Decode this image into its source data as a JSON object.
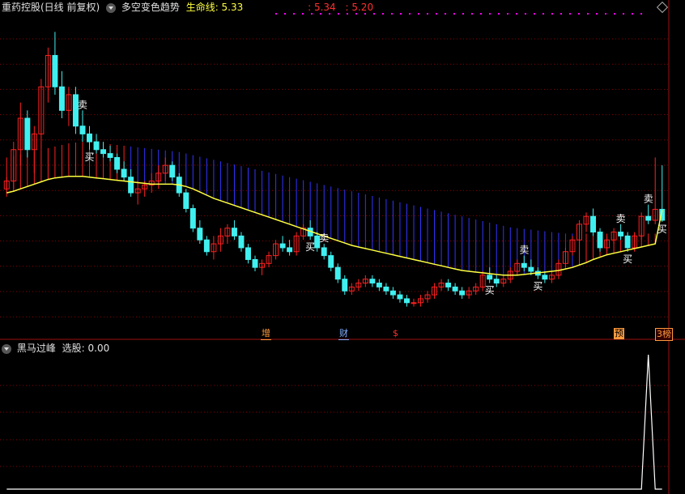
{
  "header_main": {
    "stock_title": "重药控股(日线 前复权)",
    "indicator_name": "多空变色趋势",
    "lifeline_label": "生命线: 5.33",
    "price_a": ": 5.34",
    "price_b": ": 5.20"
  },
  "header_sub": {
    "indicator_name": "黑马过峰",
    "pick_label": "选股: 0.00"
  },
  "signals": {
    "buy": "买",
    "sell": "卖"
  },
  "event_markers": [
    "增",
    "财",
    "$",
    "预",
    "3榜"
  ],
  "colors": {
    "background": "#000000",
    "up": "#ff2020",
    "down": "#40f0f0",
    "lifeline": "#ffff40",
    "band": "#3333ff",
    "grid": "#8b0000",
    "divider": "#a01010"
  },
  "chart_data": {
    "type": "candlestick",
    "ohlc": [
      [
        5.6,
        5.75,
        5.5,
        5.7
      ],
      [
        5.7,
        6.2,
        5.6,
        6.1
      ],
      [
        6.1,
        6.7,
        5.9,
        6.5
      ],
      [
        6.5,
        6.6,
        6.0,
        6.1
      ],
      [
        6.1,
        6.4,
        5.8,
        6.3
      ],
      [
        6.3,
        7.0,
        6.1,
        6.9
      ],
      [
        6.9,
        7.4,
        6.7,
        7.3
      ],
      [
        7.3,
        7.6,
        6.8,
        6.9
      ],
      [
        6.9,
        7.1,
        6.5,
        6.6
      ],
      [
        6.6,
        6.9,
        6.4,
        6.8
      ],
      [
        6.8,
        6.9,
        6.3,
        6.4
      ],
      [
        6.4,
        6.6,
        6.2,
        6.3
      ],
      [
        6.3,
        6.4,
        6.1,
        6.2
      ],
      [
        6.2,
        6.3,
        6.05,
        6.1
      ],
      [
        6.1,
        6.2,
        6.0,
        6.05
      ],
      [
        6.05,
        6.15,
        5.95,
        6.0
      ],
      [
        6.0,
        6.05,
        5.8,
        5.85
      ],
      [
        5.85,
        5.95,
        5.7,
        5.75
      ],
      [
        5.75,
        5.85,
        5.5,
        5.55
      ],
      [
        5.55,
        5.7,
        5.4,
        5.6
      ],
      [
        5.6,
        5.7,
        5.5,
        5.65
      ],
      [
        5.65,
        5.8,
        5.55,
        5.7
      ],
      [
        5.7,
        5.9,
        5.6,
        5.8
      ],
      [
        5.8,
        6.0,
        5.7,
        5.9
      ],
      [
        5.9,
        5.95,
        5.7,
        5.75
      ],
      [
        5.75,
        5.8,
        5.5,
        5.55
      ],
      [
        5.55,
        5.6,
        5.3,
        5.35
      ],
      [
        5.35,
        5.4,
        5.05,
        5.1
      ],
      [
        5.1,
        5.2,
        4.9,
        4.95
      ],
      [
        4.95,
        5.0,
        4.75,
        4.8
      ],
      [
        4.8,
        5.0,
        4.7,
        4.9
      ],
      [
        4.9,
        5.1,
        4.8,
        5.0
      ],
      [
        5.0,
        5.15,
        4.9,
        5.1
      ],
      [
        5.1,
        5.2,
        4.95,
        5.0
      ],
      [
        5.0,
        5.05,
        4.8,
        4.85
      ],
      [
        4.85,
        4.9,
        4.65,
        4.7
      ],
      [
        4.7,
        4.75,
        4.55,
        4.6
      ],
      [
        4.6,
        4.7,
        4.5,
        4.65
      ],
      [
        4.65,
        4.8,
        4.6,
        4.75
      ],
      [
        4.75,
        4.95,
        4.7,
        4.9
      ],
      [
        4.9,
        5.0,
        4.8,
        4.85
      ],
      [
        4.85,
        4.95,
        4.75,
        4.8
      ],
      [
        4.8,
        5.05,
        4.75,
        5.0
      ],
      [
        5.0,
        5.15,
        4.95,
        5.1
      ],
      [
        5.1,
        5.2,
        4.95,
        5.0
      ],
      [
        5.0,
        5.05,
        4.8,
        4.85
      ],
      [
        4.85,
        4.9,
        4.7,
        4.75
      ],
      [
        4.75,
        4.8,
        4.55,
        4.6
      ],
      [
        4.6,
        4.65,
        4.4,
        4.45
      ],
      [
        4.45,
        4.5,
        4.25,
        4.3
      ],
      [
        4.3,
        4.4,
        4.25,
        4.35
      ],
      [
        4.35,
        4.45,
        4.3,
        4.4
      ],
      [
        4.4,
        4.5,
        4.35,
        4.45
      ],
      [
        4.45,
        4.5,
        4.35,
        4.4
      ],
      [
        4.4,
        4.45,
        4.3,
        4.35
      ],
      [
        4.35,
        4.4,
        4.25,
        4.3
      ],
      [
        4.3,
        4.35,
        4.2,
        4.25
      ],
      [
        4.25,
        4.3,
        4.15,
        4.2
      ],
      [
        4.2,
        4.25,
        4.1,
        4.15
      ],
      [
        4.15,
        4.2,
        4.1,
        4.15
      ],
      [
        4.15,
        4.25,
        4.1,
        4.2
      ],
      [
        4.2,
        4.3,
        4.15,
        4.25
      ],
      [
        4.25,
        4.4,
        4.2,
        4.35
      ],
      [
        4.35,
        4.45,
        4.3,
        4.4
      ],
      [
        4.4,
        4.45,
        4.3,
        4.35
      ],
      [
        4.35,
        4.4,
        4.25,
        4.3
      ],
      [
        4.3,
        4.35,
        4.2,
        4.25
      ],
      [
        4.25,
        4.35,
        4.2,
        4.3
      ],
      [
        4.3,
        4.4,
        4.25,
        4.35
      ],
      [
        4.35,
        4.55,
        4.3,
        4.5
      ],
      [
        4.5,
        4.6,
        4.4,
        4.45
      ],
      [
        4.45,
        4.5,
        4.35,
        4.4
      ],
      [
        4.4,
        4.5,
        4.35,
        4.45
      ],
      [
        4.45,
        4.6,
        4.4,
        4.55
      ],
      [
        4.55,
        4.7,
        4.5,
        4.65
      ],
      [
        4.65,
        4.75,
        4.55,
        4.6
      ],
      [
        4.6,
        4.7,
        4.5,
        4.55
      ],
      [
        4.55,
        4.6,
        4.45,
        4.5
      ],
      [
        4.5,
        4.55,
        4.4,
        4.45
      ],
      [
        4.45,
        4.55,
        4.4,
        4.5
      ],
      [
        4.5,
        4.7,
        4.45,
        4.65
      ],
      [
        4.65,
        4.85,
        4.6,
        4.8
      ],
      [
        4.8,
        5.0,
        4.75,
        4.95
      ],
      [
        4.95,
        5.2,
        4.9,
        5.15
      ],
      [
        5.15,
        5.3,
        5.05,
        5.25
      ],
      [
        5.25,
        5.35,
        5.0,
        5.05
      ],
      [
        5.05,
        5.1,
        4.8,
        4.85
      ],
      [
        4.85,
        5.0,
        4.8,
        4.95
      ],
      [
        4.95,
        5.1,
        4.9,
        5.05
      ],
      [
        5.05,
        5.15,
        4.95,
        5.0
      ],
      [
        5.0,
        5.05,
        4.8,
        4.85
      ],
      [
        4.85,
        5.05,
        4.8,
        5.0
      ],
      [
        5.0,
        5.3,
        4.95,
        5.25
      ],
      [
        5.25,
        5.4,
        5.15,
        5.2
      ],
      [
        5.2,
        6.0,
        5.15,
        5.34
      ],
      [
        5.34,
        5.9,
        5.18,
        5.2
      ]
    ],
    "lifeline": [
      5.55,
      5.57,
      5.6,
      5.63,
      5.66,
      5.69,
      5.72,
      5.74,
      5.75,
      5.76,
      5.76,
      5.76,
      5.75,
      5.74,
      5.73,
      5.72,
      5.71,
      5.7,
      5.69,
      5.68,
      5.67,
      5.66,
      5.66,
      5.66,
      5.66,
      5.65,
      5.63,
      5.6,
      5.56,
      5.52,
      5.48,
      5.45,
      5.42,
      5.39,
      5.36,
      5.33,
      5.3,
      5.27,
      5.24,
      5.21,
      5.18,
      5.15,
      5.12,
      5.09,
      5.06,
      5.03,
      5.0,
      4.97,
      4.94,
      4.91,
      4.88,
      4.86,
      4.84,
      4.82,
      4.8,
      4.78,
      4.76,
      4.74,
      4.72,
      4.7,
      4.68,
      4.66,
      4.64,
      4.62,
      4.6,
      4.58,
      4.56,
      4.55,
      4.54,
      4.53,
      4.52,
      4.51,
      4.5,
      4.5,
      4.5,
      4.51,
      4.52,
      4.53,
      4.54,
      4.55,
      4.56,
      4.58,
      4.6,
      4.63,
      4.66,
      4.7,
      4.73,
      4.76,
      4.78,
      4.8,
      4.82,
      4.84,
      4.86,
      4.88,
      4.9,
      5.33
    ],
    "band_upper": [
      6.0,
      6.02,
      6.04,
      6.06,
      6.08,
      6.1,
      6.12,
      6.14,
      6.16,
      6.18,
      6.19,
      6.2,
      6.2,
      6.19,
      6.18,
      6.17,
      6.16,
      6.15,
      6.14,
      6.13,
      6.12,
      6.11,
      6.1,
      6.09,
      6.08,
      6.07,
      6.05,
      6.03,
      6.01,
      5.99,
      5.97,
      5.95,
      5.93,
      5.91,
      5.89,
      5.87,
      5.85,
      5.83,
      5.81,
      5.79,
      5.77,
      5.75,
      5.73,
      5.71,
      5.69,
      5.67,
      5.65,
      5.63,
      5.61,
      5.59,
      5.57,
      5.55,
      5.53,
      5.51,
      5.49,
      5.47,
      5.45,
      5.43,
      5.41,
      5.39,
      5.37,
      5.35,
      5.33,
      5.31,
      5.29,
      5.27,
      5.25,
      5.23,
      5.21,
      5.19,
      5.17,
      5.15,
      5.13,
      5.11,
      5.1,
      5.09,
      5.08,
      5.07,
      5.06,
      5.05,
      5.04,
      5.03,
      5.03,
      5.03,
      5.03,
      5.03,
      5.03,
      5.03,
      5.03,
      5.03,
      5.03,
      5.03,
      5.03,
      5.03,
      5.03,
      5.03
    ],
    "band_lower": [
      5.55,
      5.57,
      5.6,
      5.63,
      5.66,
      5.69,
      5.72,
      5.74,
      5.75,
      5.76,
      5.76,
      5.76,
      5.75,
      5.74,
      5.73,
      5.72,
      5.71,
      5.7,
      5.69,
      5.68,
      5.67,
      5.66,
      5.66,
      5.66,
      5.66,
      5.65,
      5.63,
      5.6,
      5.56,
      5.52,
      5.48,
      5.45,
      5.42,
      5.39,
      5.36,
      5.33,
      5.3,
      5.27,
      5.24,
      5.21,
      5.18,
      5.15,
      5.12,
      5.09,
      5.06,
      5.03,
      5.0,
      4.97,
      4.94,
      4.91,
      4.88,
      4.86,
      4.84,
      4.82,
      4.8,
      4.78,
      4.76,
      4.74,
      4.72,
      4.7,
      4.68,
      4.66,
      4.64,
      4.62,
      4.6,
      4.58,
      4.56,
      4.55,
      4.54,
      4.53,
      4.52,
      4.51,
      4.5,
      4.5,
      4.5,
      4.51,
      4.52,
      4.53,
      4.54,
      4.55,
      4.56,
      4.58,
      4.6,
      4.63,
      4.66,
      4.7,
      4.73,
      4.76,
      4.78,
      4.8,
      4.82,
      4.84,
      4.86,
      4.88,
      4.9,
      5.33
    ],
    "signals": [
      {
        "index": 11,
        "type": "sell"
      },
      {
        "index": 12,
        "type": "buy"
      },
      {
        "index": 44,
        "type": "buy"
      },
      {
        "index": 46,
        "type": "sell"
      },
      {
        "index": 70,
        "type": "buy"
      },
      {
        "index": 75,
        "type": "sell"
      },
      {
        "index": 77,
        "type": "buy"
      },
      {
        "index": 89,
        "type": "sell"
      },
      {
        "index": 90,
        "type": "buy"
      },
      {
        "index": 93,
        "type": "sell"
      },
      {
        "index": 95,
        "type": "buy"
      }
    ],
    "sub_values": [
      0,
      0,
      0,
      0,
      0,
      0,
      0,
      0,
      0,
      0,
      0,
      0,
      0,
      0,
      0,
      0,
      0,
      0,
      0,
      0,
      0,
      0,
      0,
      0,
      0,
      0,
      0,
      0,
      0,
      0,
      0,
      0,
      0,
      0,
      0,
      0,
      0,
      0,
      0,
      0,
      0,
      0,
      0,
      0,
      0,
      0,
      0,
      0,
      0,
      0,
      0,
      0,
      0,
      0,
      0,
      0,
      0,
      0,
      0,
      0,
      0,
      0,
      0,
      0,
      0,
      0,
      0,
      0,
      0,
      0,
      0,
      0,
      0,
      0,
      0,
      0,
      0,
      0,
      0,
      0,
      0,
      0,
      0,
      0,
      0,
      0,
      0,
      0,
      0,
      0,
      0,
      0,
      0,
      1,
      0,
      0
    ],
    "ylim": [
      3.9,
      7.8
    ]
  }
}
